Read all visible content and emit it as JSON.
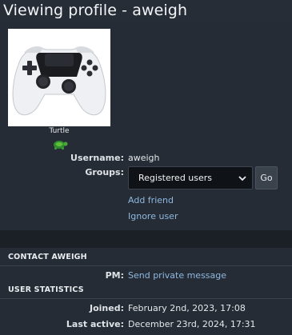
{
  "page": {
    "title": "Viewing profile - aweigh"
  },
  "profile": {
    "avatar_icon": "gamepad-controller-image",
    "rank_title": "Turtle",
    "rank_icon": "turtle-icon",
    "username_label": "Username:",
    "username_value": "aweigh",
    "groups_label": "Groups:",
    "groups_selected": "Registered users",
    "go_label": "Go",
    "add_friend": "Add friend",
    "ignore_user": "Ignore user"
  },
  "contact": {
    "header": "CONTACT AWEIGH",
    "pm_label": "PM:",
    "pm_link": "Send private message"
  },
  "stats": {
    "header": "USER STATISTICS",
    "joined_label": "Joined:",
    "joined_value": "February 2nd, 2023, 17:08",
    "last_active_label": "Last active:",
    "last_active_value": "December 23rd, 2024, 17:31"
  },
  "colors": {
    "background": "#262d36",
    "link": "#8fb8df",
    "select_bg": "#0f1317"
  }
}
